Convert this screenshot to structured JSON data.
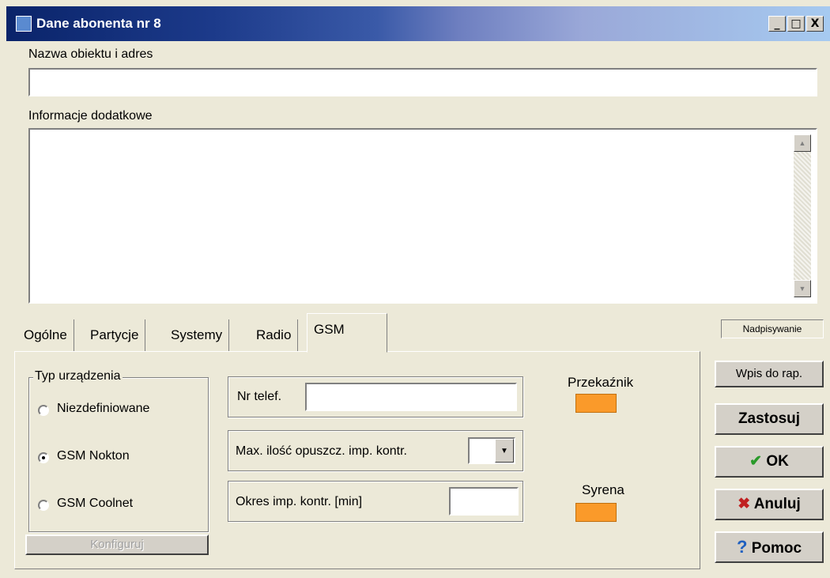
{
  "window": {
    "title": "Dane abonenta nr 8",
    "controls": {
      "minimize": "_",
      "maximize": "□",
      "close": "X"
    }
  },
  "fields": {
    "name_address": {
      "label": "Nazwa obiektu i adres",
      "value": ""
    },
    "extra_info": {
      "label": "Informacje dodatkowe",
      "value": ""
    }
  },
  "tabs": [
    {
      "label": "Ogólne"
    },
    {
      "label": "Partycje"
    },
    {
      "label": "Systemy"
    },
    {
      "label": "Radio"
    },
    {
      "label": "GSM",
      "active": true
    }
  ],
  "status_bar": {
    "mode": "Nadpisywanie"
  },
  "gsm": {
    "device_type": {
      "title": "Typ urządzenia",
      "options": [
        "Niezdefiniowane",
        "GSM Nokton",
        "GSM Coolnet"
      ],
      "selected": "GSM Nokton"
    },
    "configure_button": "Konfiguruj",
    "phone": {
      "label": "Nr telef.",
      "value": ""
    },
    "max_missed": {
      "label": "Max. ilość opuszcz. imp. kontr.",
      "value": ""
    },
    "period": {
      "label": "Okres imp. kontr. [min]",
      "value": ""
    },
    "relay": {
      "label": "Przekaźnik",
      "color": "#fa9a2a"
    },
    "siren": {
      "label": "Syrena",
      "color": "#fa9a2a"
    }
  },
  "buttons": {
    "report": "Wpis do rap.",
    "apply": "Zastosuj",
    "ok": "OK",
    "cancel": "Anuluj",
    "help": "Pomoc"
  },
  "icons": {
    "app": "app-icon",
    "ok": "checkmark-icon",
    "cancel": "x-icon",
    "help": "question-icon"
  }
}
